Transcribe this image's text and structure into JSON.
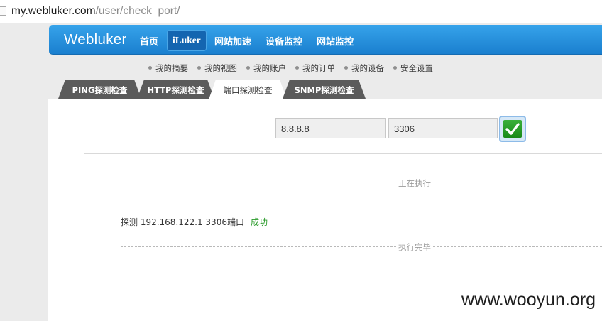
{
  "browser": {
    "url_host": "my.webluker.com",
    "url_path": "/user/check_port/"
  },
  "navbar": {
    "brand": "Webluker",
    "items": [
      {
        "label": "首页"
      },
      {
        "label": "iLuker",
        "active": true
      },
      {
        "label": "网站加速"
      },
      {
        "label": "设备监控"
      },
      {
        "label": "网站监控"
      }
    ]
  },
  "submenu": {
    "items": [
      "我的摘要",
      "我的视图",
      "我的账户",
      "我的订单",
      "我的设备",
      "安全设置"
    ]
  },
  "tabs": [
    {
      "label": "PING探测检查"
    },
    {
      "label": "HTTP探测检查"
    },
    {
      "label": "端口探测检查",
      "active": true
    },
    {
      "label": "SNMP探测检查"
    }
  ],
  "form": {
    "ip_value": "8.8.8.8",
    "port_value": "3306",
    "submit_icon": "check-icon"
  },
  "result": {
    "start_label": "正在执行",
    "line": "探测 192.168.122.1  3306端口",
    "status": "成功",
    "end_label": "执行完毕"
  },
  "watermark": "www.wooyun.org",
  "colors": {
    "nav_blue": "#1a7fcf",
    "tab_dark": "#5b5b5b",
    "success_green": "#2a9a2a"
  }
}
